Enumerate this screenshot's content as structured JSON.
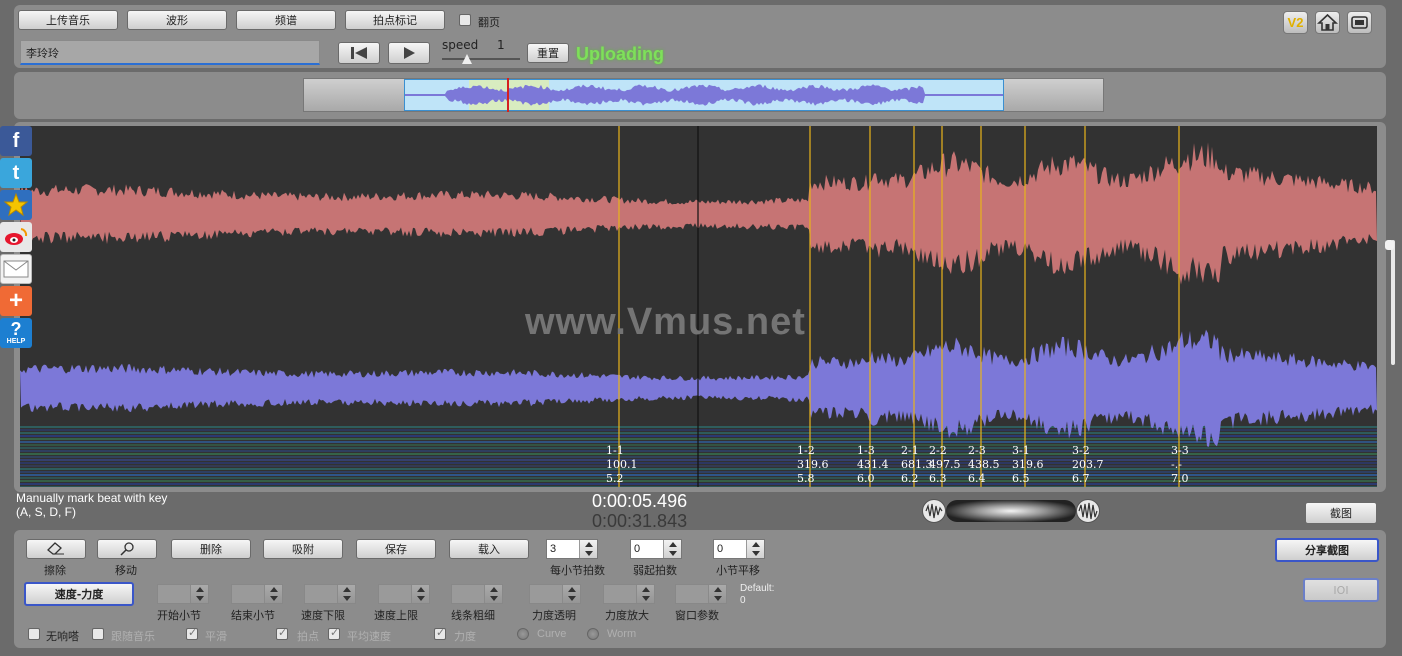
{
  "toolbar": {
    "upload_music": "上传音乐",
    "waveform": "波形",
    "spectrum": "频谱",
    "beat_marking": "拍点标记",
    "flip_page": "翻页",
    "speed_label": "speed",
    "speed_value": "1",
    "reset": "重置",
    "status": "Uploading",
    "v2_badge": "V2"
  },
  "song": {
    "title": "李玲玲"
  },
  "watermark": "www.Vmus.net",
  "beats": [
    {
      "id": "1-1",
      "tempo": "100.1",
      "time": "5.2"
    },
    {
      "id": "1-2",
      "tempo": "319.6",
      "time": "5.8"
    },
    {
      "id": "1-3",
      "tempo": "431.4",
      "time": "6.0"
    },
    {
      "id": "2-1",
      "tempo": "681.3",
      "time": "6.2"
    },
    {
      "id": "2-2",
      "tempo": "497.5",
      "time": "6.3"
    },
    {
      "id": "2-3",
      "tempo": "438.5",
      "time": "6.4"
    },
    {
      "id": "3-1",
      "tempo": "319.6",
      "time": "6.5"
    },
    {
      "id": "3-2",
      "tempo": "203.7",
      "time": "6.7"
    },
    {
      "id": "3-3",
      "tempo": "-.-",
      "time": "7.0"
    }
  ],
  "hint": {
    "line1": "Manually mark beat with key",
    "line2": "(A, S, D, F)"
  },
  "time": {
    "current": "0:00:05.496",
    "total": "0:00:31.843"
  },
  "screenshot_button": "截图",
  "share_screenshot_button": "分享截图",
  "ioi_button": "IOI",
  "tools": {
    "erase": "擦除",
    "move": "移动"
  },
  "actions": {
    "delete": "删除",
    "snap": "吸附",
    "save": "保存",
    "load": "载入"
  },
  "params": {
    "beats_per_bar": {
      "label": "每小节拍数",
      "value": "3"
    },
    "pickup_beats": {
      "label": "弱起拍数",
      "value": "0"
    },
    "bar_shift": {
      "label": "小节平移",
      "value": "0"
    }
  },
  "mode_button": "速度-力度",
  "disabled_params": {
    "start_bar": "开始小节",
    "end_bar": "结束小节",
    "speed_min": "速度下限",
    "speed_max": "速度上限",
    "line_thickness": "线条粗细",
    "force_opacity": "力度透明",
    "force_scale": "力度放大",
    "window_param": "窗口参数",
    "default_label": "Default:",
    "default_value": "0"
  },
  "options": {
    "no_beep": "无响嗒",
    "follow_music": "跟随音乐",
    "smooth": "平滑",
    "beat_point": "拍点",
    "avg_speed": "平均速度",
    "force": "力度",
    "curve": "Curve",
    "worm": "Worm"
  },
  "social": {
    "facebook": "f",
    "twitter": "t",
    "help": "HELP"
  },
  "colors": {
    "upper_wave": "#c67474",
    "lower_wave": "#7c78d8",
    "beat_line": "#e8b51c",
    "uploading": "#7ee05a",
    "canvas_bg": "#323232"
  }
}
